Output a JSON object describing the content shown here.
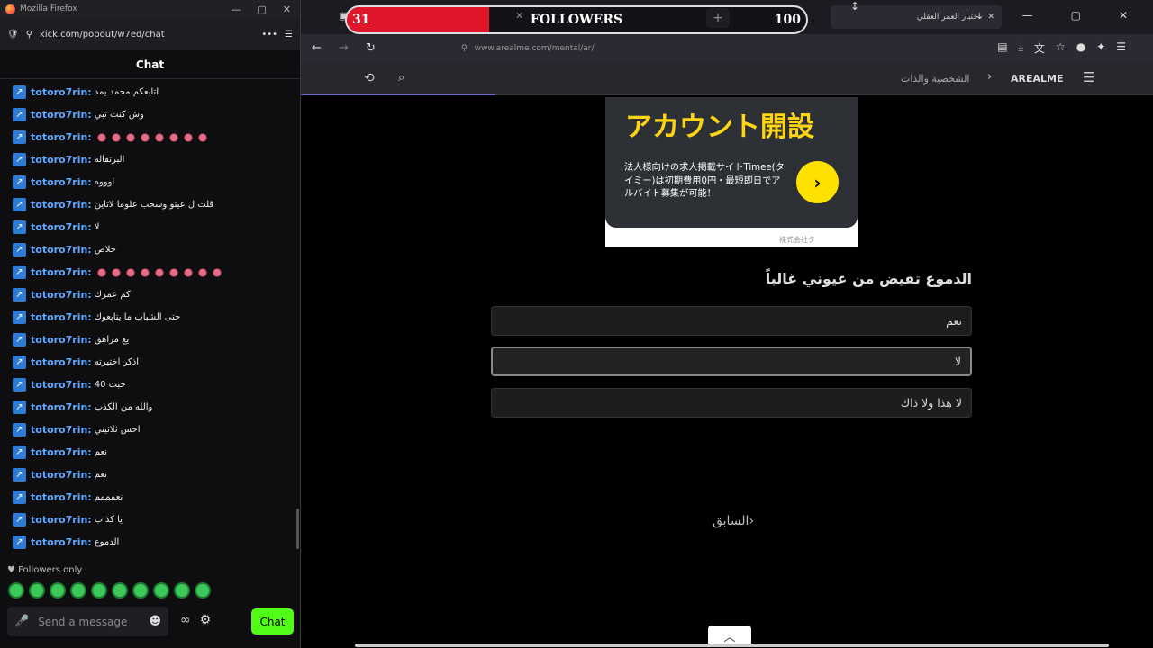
{
  "left_window": {
    "title": "Mozilla Firefox",
    "url": "kick.com/popout/w7ed/chat",
    "chat_title": "Chat",
    "messages": [
      {
        "user": "totoro7rin:",
        "text": "اتابعكم محمد يمد"
      },
      {
        "user": "totoro7rin:",
        "text": "وش كنت تبي"
      },
      {
        "user": "totoro7rin:",
        "text": "",
        "emotes": 8
      },
      {
        "user": "totoro7rin:",
        "text": "البرتقاله"
      },
      {
        "user": "totoro7rin:",
        "text": "اوووه"
      },
      {
        "user": "totoro7rin:",
        "text": "قلت ل عيتو وسحب علوما لاتاين"
      },
      {
        "user": "totoro7rin:",
        "text": "لا"
      },
      {
        "user": "totoro7rin:",
        "text": "خلاص"
      },
      {
        "user": "totoro7rin:",
        "text": "",
        "emotes": 9
      },
      {
        "user": "totoro7rin:",
        "text": "كم عمرك"
      },
      {
        "user": "totoro7rin:",
        "text": "حتى الشباب ما يتابعوك"
      },
      {
        "user": "totoro7rin:",
        "text": "يع مراهق"
      },
      {
        "user": "totoro7rin:",
        "text": "اذكر اختبرته"
      },
      {
        "user": "totoro7rin:",
        "text": "جبت 40"
      },
      {
        "user": "totoro7rin:",
        "text": "والله من الكذب"
      },
      {
        "user": "totoro7rin:",
        "text": "احس ثلاثيني"
      },
      {
        "user": "totoro7rin:",
        "text": "نعم"
      },
      {
        "user": "totoro7rin:",
        "text": "نعم"
      },
      {
        "user": "totoro7rin:",
        "text": "نعمممم"
      },
      {
        "user": "totoro7rin:",
        "text": "يا كذاب"
      },
      {
        "user": "totoro7rin:",
        "text": "الدموع"
      }
    ],
    "followers_only": "Followers only",
    "input_placeholder": "Send a message",
    "chat_button": "Chat"
  },
  "tab": {
    "title": "اختبار العمر العقلي"
  },
  "overlay": {
    "current": "31",
    "label": "FOLLOWERS",
    "goal": "100",
    "progress": 0.31
  },
  "nav": {
    "url": "www.arealme.com/mental/ar/"
  },
  "site": {
    "logo": "AREALME",
    "category": "الشخصية والذات"
  },
  "ad": {
    "heading": "アカウント開設",
    "body": "法人様向けの求人掲載サイトTimee(タイミー)は初期費用0円・最短即日でアルバイト募集が可能！",
    "footer": "株式会社タ"
  },
  "question": {
    "text": "الدموع تفيض من عيوني غالباً",
    "options": [
      "نعم",
      "لا",
      "لا هذا ولا ذاك"
    ]
  },
  "prev_button": "السابق",
  "colors": {
    "kick_green": "#53fc18",
    "overlay_red": "#e0162b",
    "ad_yellow": "#ffd513"
  }
}
